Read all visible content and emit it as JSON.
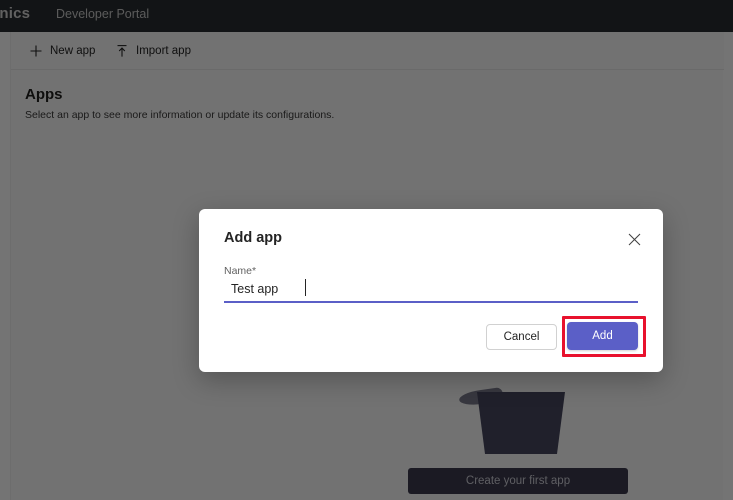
{
  "window": {
    "topbar": {
      "brand": "onics",
      "title": "Developer Portal"
    }
  },
  "toolbar": {
    "new_app_label": "New app",
    "new_app_icon": "plus-icon",
    "import_app_label": "Import app",
    "import_app_icon": "upload-arrow-icon"
  },
  "main": {
    "heading": "Apps",
    "subheading": "Select an app to see more information or update its configurations.",
    "empty_state": {
      "cta_label": "Create your first app"
    }
  },
  "dialog": {
    "title": "Add app",
    "close_icon": "close-icon",
    "field": {
      "label": "Name*",
      "value": "Test app",
      "placeholder": ""
    },
    "cancel_label": "Cancel",
    "add_label": "Add"
  },
  "colors": {
    "topbar_bg": "#292d31",
    "page_bg": "#fbfbfb",
    "accent_purple": "#5b5fc7",
    "highlight_red": "#e8112d",
    "scrim": "rgba(0,0,0,0.545)",
    "cta_bg": "#3c3b4e",
    "illustration": "#474860"
  }
}
